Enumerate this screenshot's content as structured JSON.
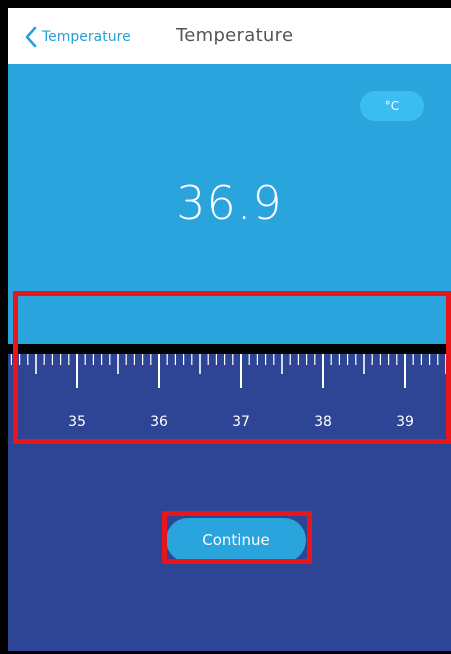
{
  "header": {
    "back_label": "Temperature",
    "title": "Temperature",
    "icons": {
      "back": "chevron-left-icon"
    }
  },
  "display": {
    "unit": "°C",
    "reading": "36.9"
  },
  "ruler": {
    "current_value": 36.9,
    "labels": [
      "35",
      "36",
      "37",
      "38",
      "39"
    ],
    "label_values": [
      35,
      36,
      37,
      38,
      39
    ],
    "icons": {
      "pointer": "caret-down-icon"
    }
  },
  "actions": {
    "continue_label": "Continue"
  },
  "colors": {
    "accent": "#29a4dd",
    "chip": "#3bbdf2",
    "ruler_background": "#2e4495",
    "pointer": "#2e4495",
    "highlight": "#e8161b"
  }
}
